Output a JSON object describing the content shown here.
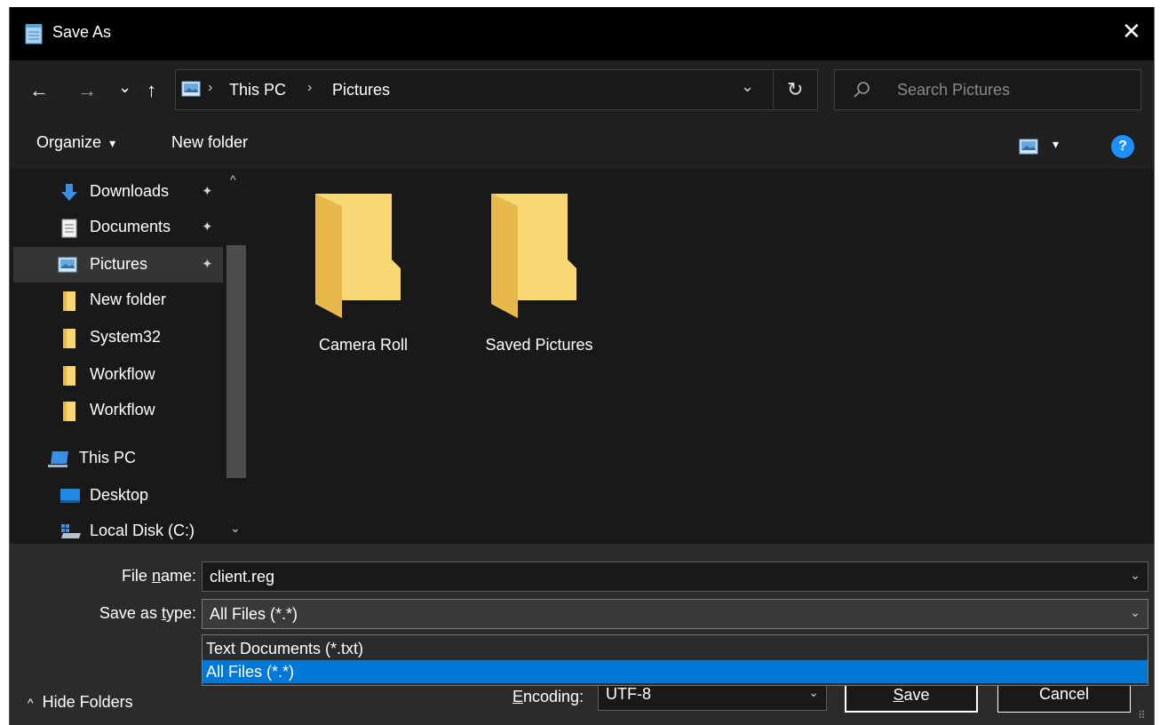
{
  "window": {
    "title": "Save As",
    "close_glyph": "✕"
  },
  "nav": {
    "back_glyph": "←",
    "forward_glyph": "→",
    "recent_glyph": "⌄",
    "up_glyph": "↑",
    "breadcrumbs": [
      "This PC",
      "Pictures"
    ],
    "crumb_sep": "›",
    "dropdown_glyph": "⌄",
    "refresh_glyph": "↻",
    "search_placeholder": "Search Pictures"
  },
  "toolbar": {
    "organize_label": "Organize",
    "organize_glyph": "▾",
    "new_folder_label": "New folder",
    "view_glyph": "▾",
    "help_glyph": "?"
  },
  "sidebar": {
    "items": [
      {
        "label": "Downloads",
        "icon": "download-arrow-icon",
        "pinned": true
      },
      {
        "label": "Documents",
        "icon": "document-icon",
        "pinned": true
      },
      {
        "label": "Pictures",
        "icon": "pictures-icon",
        "pinned": true,
        "selected": true
      },
      {
        "label": "New folder",
        "icon": "folder-icon"
      },
      {
        "label": "System32",
        "icon": "folder-icon"
      },
      {
        "label": "Workflow",
        "icon": "folder-icon"
      },
      {
        "label": "Workflow",
        "icon": "folder-icon"
      },
      {
        "label": "This PC",
        "icon": "computer-icon"
      },
      {
        "label": "Desktop",
        "icon": "desktop-icon"
      },
      {
        "label": "Local Disk (C:)",
        "icon": "local-disk-icon"
      }
    ],
    "pin_glyph": "📌",
    "scroll_up_glyph": "^",
    "scroll_down_glyph": "⌄"
  },
  "content": {
    "folders": [
      "Camera Roll",
      "Saved Pictures"
    ]
  },
  "form": {
    "file_name_label_pre": "File ",
    "file_name_label_u": "n",
    "file_name_label_post": "ame:",
    "file_name_value": "client.reg",
    "save_type_label_pre": "Save as ",
    "save_type_label_u": "t",
    "save_type_label_post": "ype:",
    "save_type_value": "All Files  (*.*)",
    "save_type_options": [
      "Text Documents (*.txt)",
      "All Files  (*.*)"
    ],
    "encoding_label_pre": "",
    "encoding_label_u": "E",
    "encoding_label_post": "ncoding:",
    "encoding_value": "UTF-8",
    "chevron_glyph": "⌄",
    "hide_folders_glyph": "^",
    "hide_folders_label": "Hide Folders",
    "save_label_u": "S",
    "save_label_post": "ave",
    "cancel_label": "Cancel"
  },
  "colors": {
    "accent": "#0078d7",
    "folder": "#f8d775",
    "folder_dark": "#e6b94a",
    "help": "#1e90ff"
  }
}
